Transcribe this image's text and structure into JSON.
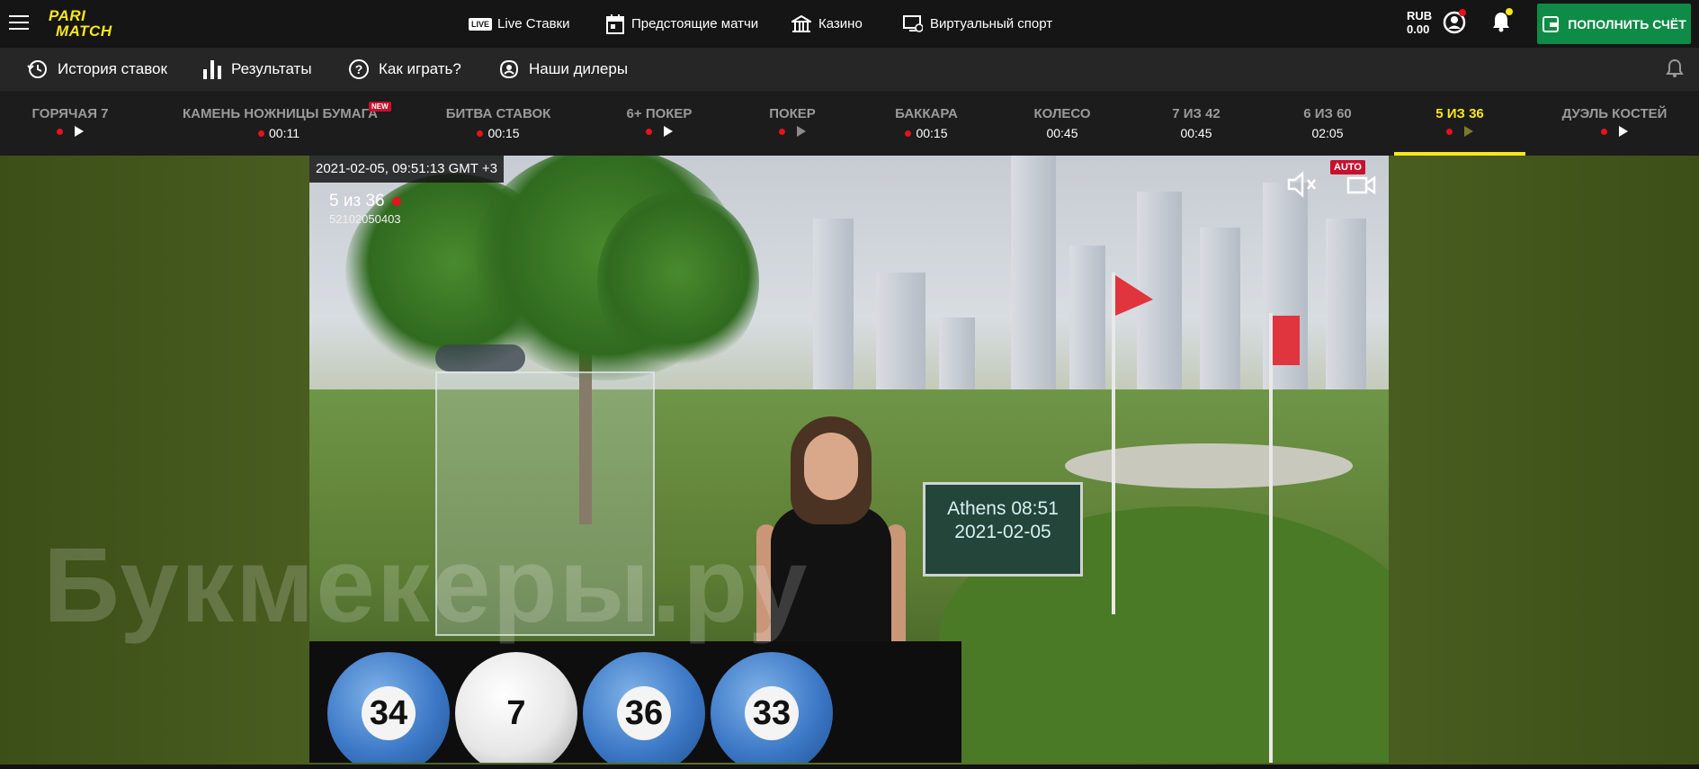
{
  "topbar": {
    "logo_line1": "PARI",
    "logo_line2": "MATCH",
    "nav": [
      {
        "badge": "LIVE",
        "label": "Live Ставки",
        "icon": "live-icon"
      },
      {
        "label": "Предстоящие матчи",
        "icon": "calendar-icon"
      },
      {
        "label": "Казино",
        "icon": "casino-icon"
      },
      {
        "label": "Виртуальный спорт",
        "icon": "monitor-icon"
      }
    ],
    "currency": "RUB",
    "balance": "0.00",
    "deposit_label": "ПОПОЛНИТЬ СЧЁТ"
  },
  "subnav": [
    {
      "label": "История ставок",
      "icon": "history-icon"
    },
    {
      "label": "Результаты",
      "icon": "chart-icon"
    },
    {
      "label": "Как играть?",
      "icon": "help-icon"
    },
    {
      "label": "Наши дилеры",
      "icon": "dealer-icon"
    }
  ],
  "games": [
    {
      "name": "ГОРЯЧАЯ 7",
      "status": ""
    },
    {
      "name": "КАМЕНЬ НОЖНИЦЫ БУМАГА",
      "badge": "NEW",
      "status": "00:11"
    },
    {
      "name": "БИТВА СТАВОК",
      "status": "00:15"
    },
    {
      "name": "6+ ПОКЕР",
      "status": ""
    },
    {
      "name": "ПОКЕР",
      "status": ""
    },
    {
      "name": "БАККАРА",
      "status": "00:15"
    },
    {
      "name": "КОЛЕСО",
      "status": "00:45"
    },
    {
      "name": "7 ИЗ 42",
      "status": "00:45"
    },
    {
      "name": "6 ИЗ 60",
      "status": "02:05"
    },
    {
      "name": "5 ИЗ 36",
      "status": ""
    },
    {
      "name": "ДУЭЛЬ КОСТЕЙ",
      "status": ""
    }
  ],
  "video": {
    "timestamp": "2021-02-05, 09:51:13 GMT +3",
    "title": "5 из 36",
    "round_id": "52102050403",
    "auto_label": "AUTO",
    "board_line1": "Athens 08:51",
    "board_line2": "2021-02-05",
    "balls": [
      "34",
      "7",
      "36",
      "33"
    ]
  },
  "watermark": "Букмекеры.ру",
  "colors": {
    "accent": "#f8e71c",
    "deposit": "#0e8b46",
    "live_dot": "#e5131e"
  }
}
